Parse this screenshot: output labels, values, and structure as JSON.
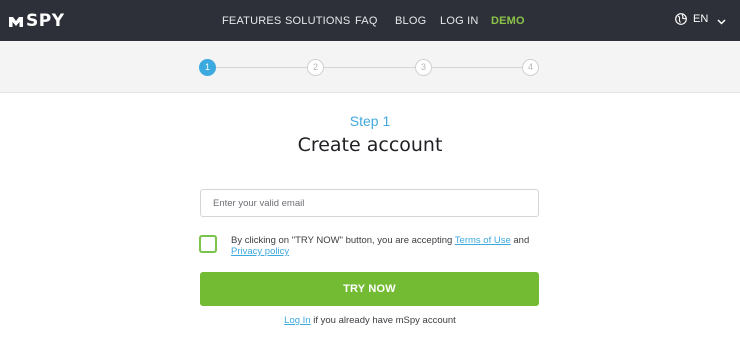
{
  "header": {
    "logo_text": "SPY",
    "nav": [
      {
        "label": "FEATURES"
      },
      {
        "label": "SOLUTIONS"
      },
      {
        "label": "FAQ"
      },
      {
        "label": "BLOG"
      },
      {
        "label": "LOG IN"
      },
      {
        "label": "DEMO"
      }
    ],
    "language": "EN"
  },
  "stepper": {
    "steps": [
      "1",
      "2",
      "3",
      "4"
    ],
    "active": 1
  },
  "form": {
    "step_label": "Step 1",
    "title": "Create account",
    "email_placeholder": "Enter your valid email",
    "email_value": "",
    "terms": {
      "prefix": "By clicking on \"TRY NOW\" button, you are accepting ",
      "terms_link": "Terms of Use",
      "and": " and ",
      "privacy_link": "Privacy policy"
    },
    "cta_label": "TRY NOW",
    "login_link": "Log In",
    "login_suffix": " if you already have mSpy account"
  },
  "colors": {
    "topbar": "#2d3038",
    "accent_blue": "#3ca9df",
    "accent_green": "#72bb32",
    "demo_green": "#8bc34a"
  },
  "icons": {
    "language": "globe-icon",
    "dropdown": "chevron-down-icon",
    "logo": "mspy-logo"
  }
}
